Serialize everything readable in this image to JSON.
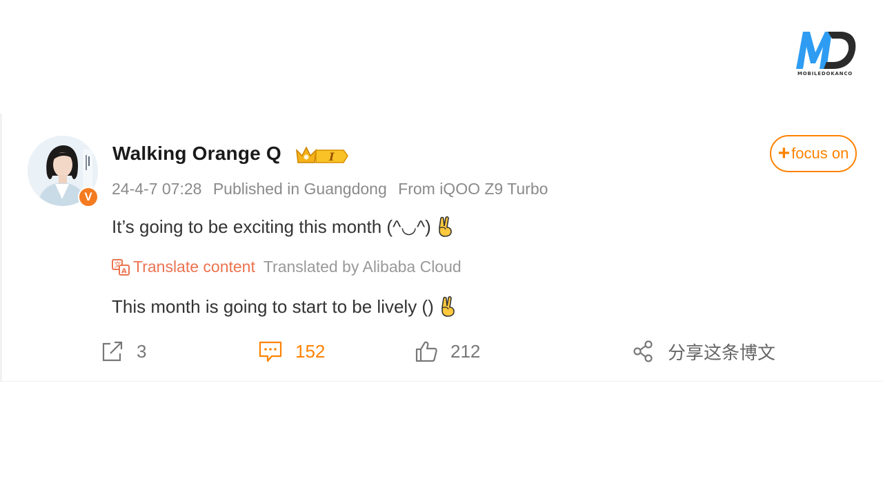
{
  "watermark": {
    "caption": "MOBILEDOKANCO"
  },
  "post": {
    "username": "Walking Orange Q",
    "badge_level": "I",
    "follow_label": "focus on",
    "timestamp": "24-4-7 07:28",
    "location": "Published in Guangdong",
    "source": "From iQOO Z9 Turbo",
    "text": "It’s going to be exciting this month (^◡^)",
    "translate_label": "Translate content",
    "translated_by": "Translated by Alibaba Cloud",
    "translated_text": "This month is going to start to be lively ()"
  },
  "actions": {
    "repost_count": "3",
    "comment_count": "152",
    "like_count": "212",
    "share_label": "分享这条博文"
  },
  "colors": {
    "accent_orange": "#ff8200",
    "translate_orange": "#eb7350",
    "verified_orange": "#f47b20"
  },
  "icons": [
    "repost-icon",
    "comment-icon",
    "like-icon",
    "share-icon",
    "translate-icon",
    "verified-badge-icon",
    "crown-level-badge-icon",
    "victory-hand-icon"
  ]
}
